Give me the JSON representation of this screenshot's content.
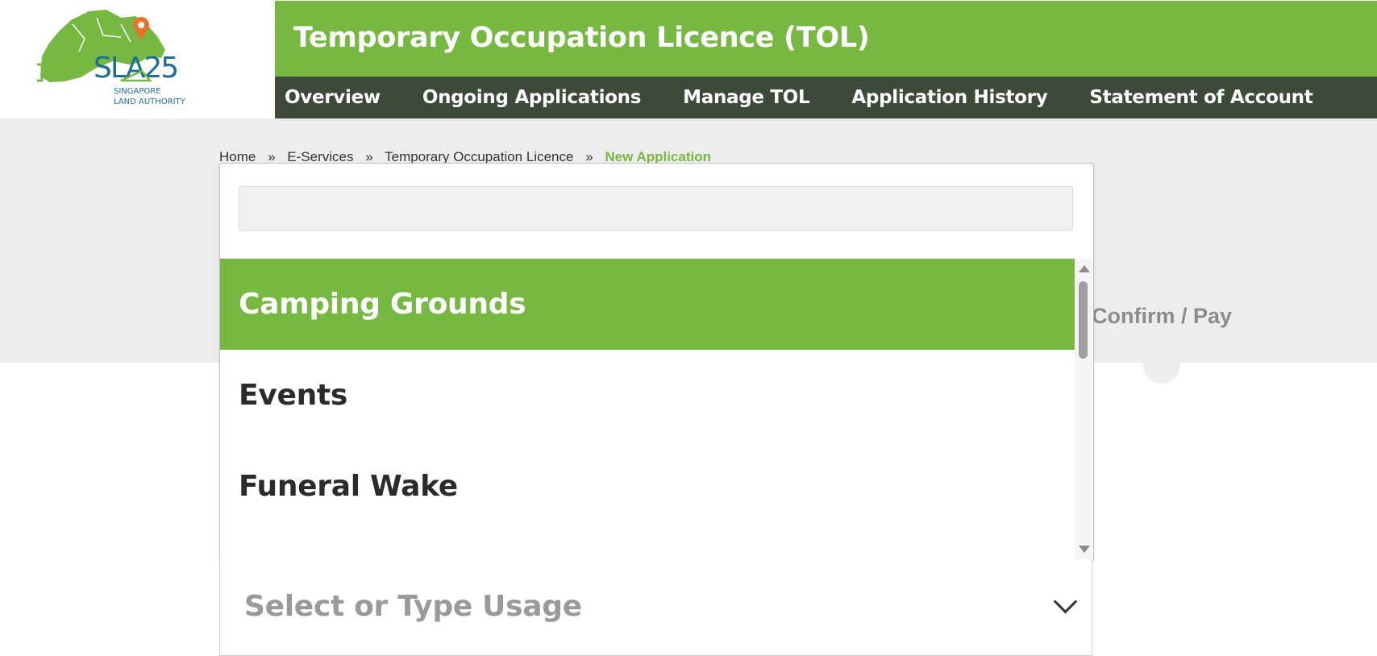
{
  "logo": {
    "mark": "SLA25",
    "org_line1": "SINGAPORE",
    "org_line2": "LAND AUTHORITY",
    "brand_green": "#77b843",
    "brand_blue": "#1f6e94",
    "pin_orange": "#e8702a"
  },
  "header": {
    "title": "Temporary Occupation Licence (TOL)",
    "title_bg": "#77b843",
    "nav_bg": "#3d4a3a"
  },
  "nav": {
    "items": [
      {
        "label": "Overview"
      },
      {
        "label": "Ongoing Applications"
      },
      {
        "label": "Manage TOL"
      },
      {
        "label": "Application History"
      },
      {
        "label": "Statement of Account"
      }
    ]
  },
  "breadcrumb": {
    "items": [
      "Home",
      "E-Services",
      "Temporary Occupation Licence"
    ],
    "separator": "»",
    "current": "New Application"
  },
  "steps": {
    "visible_label": "Confirm / Pay"
  },
  "dropdown": {
    "search_value": "",
    "options": [
      {
        "label": "Camping Grounds",
        "selected": true
      },
      {
        "label": "Events",
        "selected": false
      },
      {
        "label": "Funeral Wake",
        "selected": false
      }
    ],
    "select_placeholder": "Select or Type Usage",
    "icons": {
      "scroll_up": "triangle-up-icon",
      "scroll_down": "triangle-down-icon",
      "toggle": "chevron-down-icon"
    }
  }
}
